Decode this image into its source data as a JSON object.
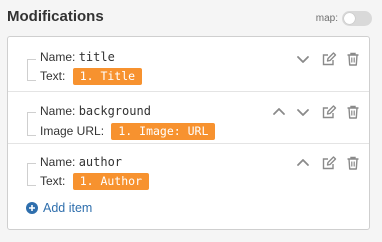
{
  "header": {
    "title": "Modifications",
    "map_label": "map:",
    "map_enabled": false
  },
  "modifications": [
    {
      "name_label": "Name:",
      "name": "title",
      "value_label": "Text:",
      "value": "1. Title",
      "controls": [
        "chevron-down-icon",
        "edit-icon",
        "trash-icon"
      ]
    },
    {
      "name_label": "Name:",
      "name": "background",
      "value_label": "Image URL:",
      "value": "1. Image: URL",
      "controls": [
        "chevron-up-icon",
        "chevron-down-icon",
        "edit-icon",
        "trash-icon"
      ]
    },
    {
      "name_label": "Name:",
      "name": "author",
      "value_label": "Text:",
      "value": "1. Author",
      "controls": [
        "chevron-up-icon",
        "edit-icon",
        "trash-icon"
      ]
    }
  ],
  "add_item": {
    "label": "Add item"
  },
  "colors": {
    "accent": "#f7922f",
    "link": "#2f6fad",
    "icon": "#8a8a8a",
    "background": "#f5f5f5"
  }
}
